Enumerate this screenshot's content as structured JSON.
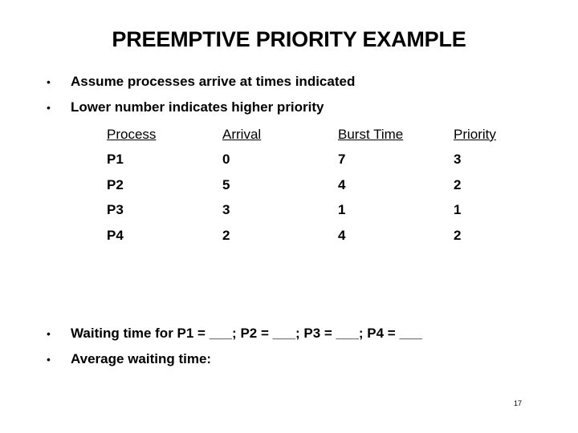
{
  "slide": {
    "title": "PREEMPTIVE PRIORITY EXAMPLE",
    "bullets_top": [
      {
        "marker": "•",
        "text": "Assume processes arrive at times indicated"
      },
      {
        "marker": "•",
        "text": "Lower number indicates higher priority"
      }
    ],
    "table": {
      "headers": [
        "Process",
        "Arrival",
        "Burst Time",
        "Priority"
      ],
      "rows": [
        [
          "P1",
          "0",
          "7",
          "3"
        ],
        [
          "P2",
          "5",
          "4",
          "2"
        ],
        [
          "P3",
          "3",
          "1",
          "1"
        ],
        [
          "P4",
          "2",
          "4",
          "2"
        ]
      ]
    },
    "bullets_bottom": [
      {
        "marker": "•",
        "text": "Waiting time for P1 = ___; P2 = ___; P3 = ___; P4 = ___"
      },
      {
        "marker": "•",
        "text": "Average waiting time:"
      }
    ],
    "page_number": "17"
  }
}
